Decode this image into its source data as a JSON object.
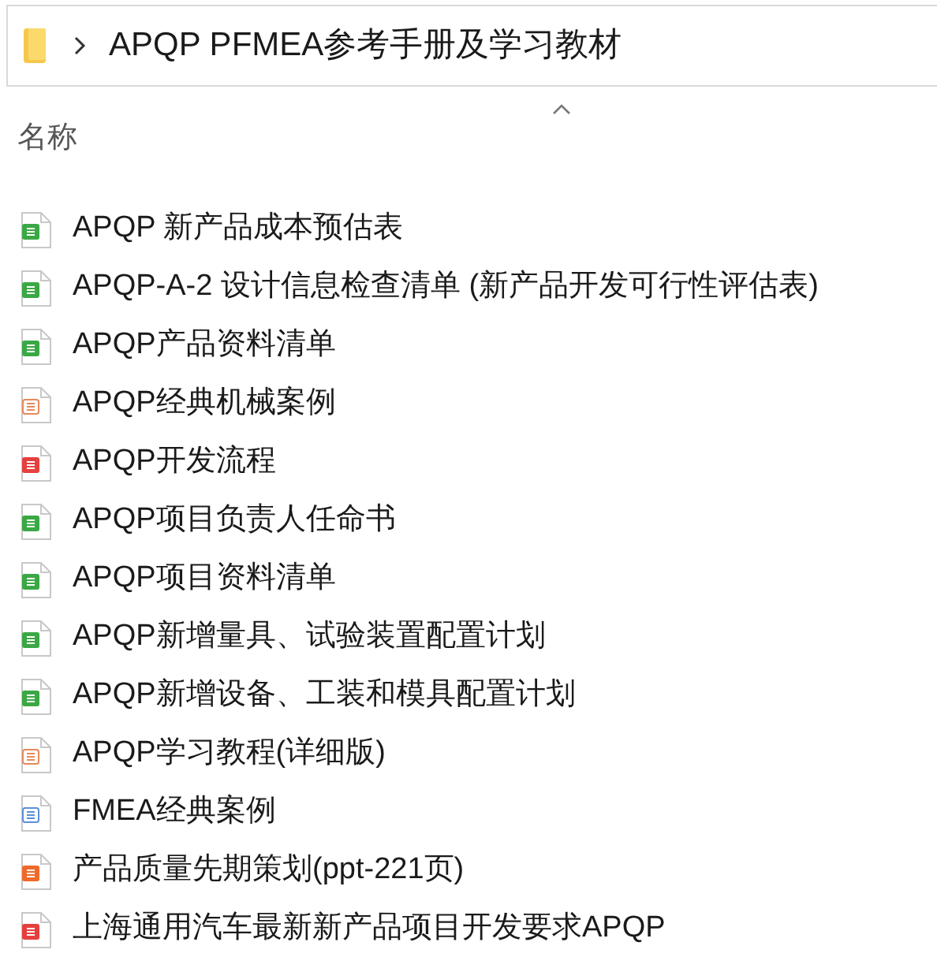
{
  "breadcrumb": {
    "path": "APQP PFMEA参考手册及学习教材"
  },
  "column_header": {
    "label": "名称"
  },
  "files": [
    {
      "name": "APQP 新产品成本预估表",
      "kind": "sheet"
    },
    {
      "name": "APQP-A-2 设计信息检查清单 (新产品开发可行性评估表)",
      "kind": "sheet"
    },
    {
      "name": "APQP产品资料清单",
      "kind": "sheet"
    },
    {
      "name": "APQP经典机械案例",
      "kind": "slides_outline"
    },
    {
      "name": "APQP开发流程",
      "kind": "pdf"
    },
    {
      "name": "APQP项目负责人任命书",
      "kind": "sheet"
    },
    {
      "name": "APQP项目资料清单",
      "kind": "sheet"
    },
    {
      "name": "APQP新增量具、试验装置配置计划",
      "kind": "sheet"
    },
    {
      "name": "APQP新增设备、工装和模具配置计划",
      "kind": "sheet"
    },
    {
      "name": "APQP学习教程(详细版)",
      "kind": "slides_outline"
    },
    {
      "name": "FMEA经典案例",
      "kind": "doc"
    },
    {
      "name": "产品质量先期策划(ppt-221页)",
      "kind": "slides"
    },
    {
      "name": "上海通用汽车最新新产品项目开发要求APQP",
      "kind": "pdf"
    }
  ]
}
